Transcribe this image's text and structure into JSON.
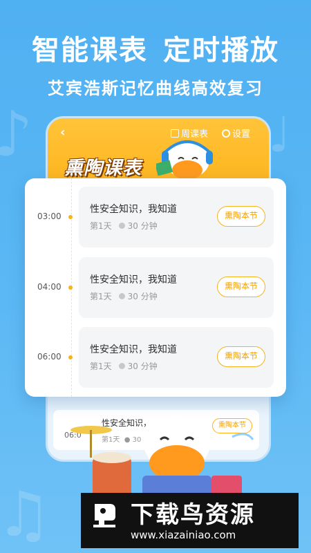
{
  "headline": {
    "left": "智能课表",
    "right": "定时播放"
  },
  "subline": "艾宾浩斯记忆曲线高效复习",
  "phone": {
    "back_icon": "back-chevron-icon",
    "weekly_label": "周课表",
    "weekly_icon": "calendar-icon",
    "settings_label": "设置",
    "settings_icon": "gear-icon",
    "header_title": "熏陶课表",
    "background_row": {
      "time": "06:0",
      "title": "性安全知识，",
      "day": "第1天",
      "duration": "30",
      "button": "熏陶本节"
    }
  },
  "schedule": [
    {
      "time": "03:00",
      "title": "性安全知识，我知道",
      "day": "第1天",
      "duration": "30 分钟",
      "button": "熏陶本节"
    },
    {
      "time": "04:00",
      "title": "性安全知识，我知道",
      "day": "第1天",
      "duration": "30 分钟",
      "button": "熏陶本节"
    },
    {
      "time": "06:00",
      "title": "性安全知识，我知道",
      "day": "第1天",
      "duration": "30 分钟",
      "button": "熏陶本节"
    }
  ],
  "watermark": {
    "name": "下载鸟资源",
    "url": "www.xiazainiao.com"
  },
  "colors": {
    "background": "#5cb8f4",
    "accent": "#ffb21a",
    "card": "#ffffff"
  }
}
